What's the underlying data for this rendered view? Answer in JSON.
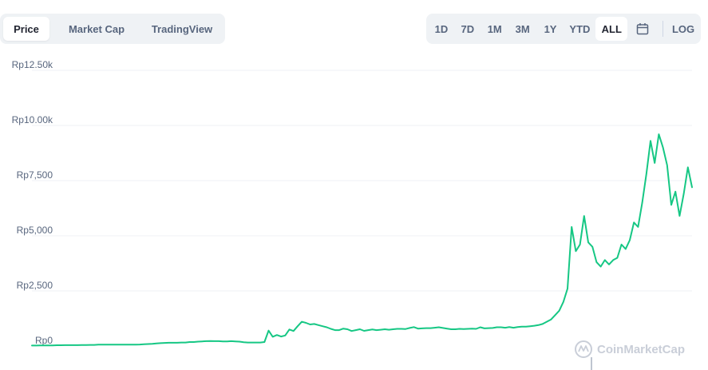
{
  "tabs": [
    {
      "label": "Price",
      "active": true
    },
    {
      "label": "Market Cap",
      "active": false
    },
    {
      "label": "TradingView",
      "active": false
    }
  ],
  "ranges": [
    {
      "label": "1D",
      "active": false
    },
    {
      "label": "7D",
      "active": false
    },
    {
      "label": "1M",
      "active": false
    },
    {
      "label": "3M",
      "active": false
    },
    {
      "label": "1Y",
      "active": false
    },
    {
      "label": "YTD",
      "active": false
    },
    {
      "label": "ALL",
      "active": true
    }
  ],
  "calendar_icon": "calendar-icon",
  "log_label": "LOG",
  "watermark": "CoinMarketCap",
  "colors": {
    "line": "#16c784",
    "grid": "#eff2f5",
    "axis_text": "#58667e"
  },
  "chart_data": {
    "type": "line",
    "title": "",
    "xlabel": "",
    "ylabel": "",
    "ylim": [
      0,
      12500
    ],
    "yticks": [
      {
        "value": 0,
        "label": "Rp0"
      },
      {
        "value": 2500,
        "label": "Rp2,500"
      },
      {
        "value": 5000,
        "label": "Rp5,000"
      },
      {
        "value": 7500,
        "label": "Rp7,500"
      },
      {
        "value": 10000,
        "label": "Rp10.00k"
      },
      {
        "value": 12500,
        "label": "Rp12.50k"
      }
    ],
    "grid": true,
    "series": [
      {
        "values": [
          20,
          20,
          25,
          25,
          30,
          30,
          35,
          35,
          40,
          40,
          40,
          40,
          45,
          45,
          50,
          50,
          60,
          60,
          60,
          60,
          60,
          60,
          60,
          60,
          65,
          65,
          70,
          80,
          90,
          100,
          120,
          130,
          140,
          150,
          150,
          150,
          160,
          160,
          180,
          180,
          200,
          210,
          220,
          230,
          220,
          220,
          210,
          210,
          220,
          210,
          200,
          170,
          160,
          160,
          160,
          160,
          180,
          700,
          420,
          500,
          430,
          480,
          750,
          680,
          900,
          1100,
          1050,
          980,
          1000,
          950,
          900,
          850,
          780,
          720,
          720,
          790,
          760,
          680,
          720,
          760,
          690,
          720,
          750,
          720,
          740,
          760,
          740,
          760,
          780,
          780,
          770,
          820,
          860,
          790,
          800,
          810,
          810,
          830,
          850,
          820,
          790,
          760,
          760,
          780,
          770,
          780,
          790,
          780,
          850,
          800,
          810,
          820,
          850,
          850,
          830,
          860,
          830,
          860,
          880,
          880,
          900,
          920,
          950,
          1000,
          1100,
          1200,
          1400,
          1600,
          2000,
          2600,
          5400,
          4300,
          4600,
          5900,
          4700,
          4500,
          3800,
          3600,
          3900,
          3700,
          3900,
          4000,
          4600,
          4400,
          4800,
          5600,
          5400,
          6500,
          7800,
          9300,
          8300,
          9600,
          9000,
          8200,
          6400,
          7000,
          5900,
          6900,
          8100,
          7200
        ]
      }
    ]
  }
}
